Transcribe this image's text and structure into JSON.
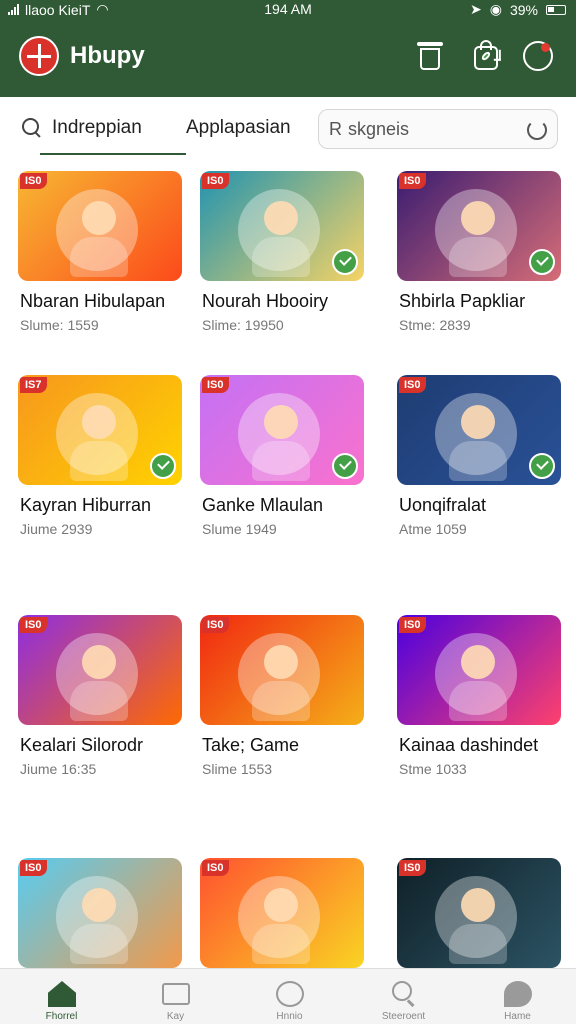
{
  "status": {
    "carrier": "llaoo KieiT",
    "time": "194 AM",
    "battery": "39%"
  },
  "header": {
    "app_title": "Hbupy",
    "icons": [
      "trash-icon",
      "shopping-bag-check-icon",
      "profile-notification-icon"
    ],
    "colors": {
      "header_bg": "#2f5a35",
      "logo": "#d8322a",
      "badge": "#d8322a",
      "check": "#43a047"
    }
  },
  "tabs": [
    {
      "label": "Indreppian",
      "active": true
    },
    {
      "label": "Applapasian",
      "active": false
    }
  ],
  "search": {
    "value": "skgneis",
    "display": "R skgneis"
  },
  "games": [
    {
      "badge": "IS0",
      "title": "Nbaran Hibulapan",
      "meta": "Slume: 1559",
      "checked": false,
      "thumb": "linear-gradient(135deg,#f7b733,#fc4a1a)"
    },
    {
      "badge": "IS0",
      "title": "Nourah Hbooiry",
      "meta": "Slime: 19950",
      "checked": true,
      "thumb": "linear-gradient(135deg,#2193b0,#f6d365)"
    },
    {
      "badge": "IS0",
      "title": "Shbirla Papkliar",
      "meta": "Stme: 2839",
      "checked": true,
      "thumb": "linear-gradient(135deg,#3a1c71,#d76d77)"
    },
    {
      "badge": "IS7",
      "title": "Kayran Hiburran",
      "meta": "Jiume 2939",
      "checked": true,
      "thumb": "linear-gradient(135deg,#f7971e,#ffd200)"
    },
    {
      "badge": "IS0",
      "title": "Ganke Mlaulan",
      "meta": "Slume 1949",
      "checked": true,
      "thumb": "linear-gradient(135deg,#c471f5,#fa71cd)"
    },
    {
      "badge": "IS0",
      "title": "Uonqifralat",
      "meta": "Atme 1059",
      "checked": true,
      "thumb": "linear-gradient(135deg,#1e3c72,#2a5298)"
    },
    {
      "badge": "IS0",
      "title": "Kealari Silorodr",
      "meta": "Jiume 16:35",
      "checked": false,
      "thumb": "linear-gradient(135deg,#8e2de2,#ff6a00)"
    },
    {
      "badge": "IS0",
      "title": "Take; Game",
      "meta": "Slime 1553",
      "checked": false,
      "thumb": "linear-gradient(135deg,#f12711,#f5af19)"
    },
    {
      "badge": "IS0",
      "title": "Kainaa dashindet",
      "meta": "Stme 1033",
      "checked": false,
      "thumb": "linear-gradient(135deg,#4a00e0,#ff416c)"
    },
    {
      "badge": "IS0",
      "title": "",
      "meta": "",
      "checked": false,
      "thumb": "linear-gradient(135deg,#56ccf2,#f2994a)"
    },
    {
      "badge": "IS0",
      "title": "",
      "meta": "",
      "checked": false,
      "thumb": "linear-gradient(135deg,#ff512f,#f9d423)"
    },
    {
      "badge": "IS0",
      "title": "",
      "meta": "",
      "checked": false,
      "thumb": "linear-gradient(135deg,#0f2027,#2c5364)"
    }
  ],
  "bottom_nav": [
    {
      "label": "Fhorrel",
      "icon": "home-icon",
      "active": true
    },
    {
      "label": "Kay",
      "icon": "category-icon",
      "active": false
    },
    {
      "label": "Hnnio",
      "icon": "play-icon",
      "active": false
    },
    {
      "label": "Steeroent",
      "icon": "search-icon",
      "active": false
    },
    {
      "label": "Hame",
      "icon": "chat-icon",
      "active": false
    }
  ]
}
